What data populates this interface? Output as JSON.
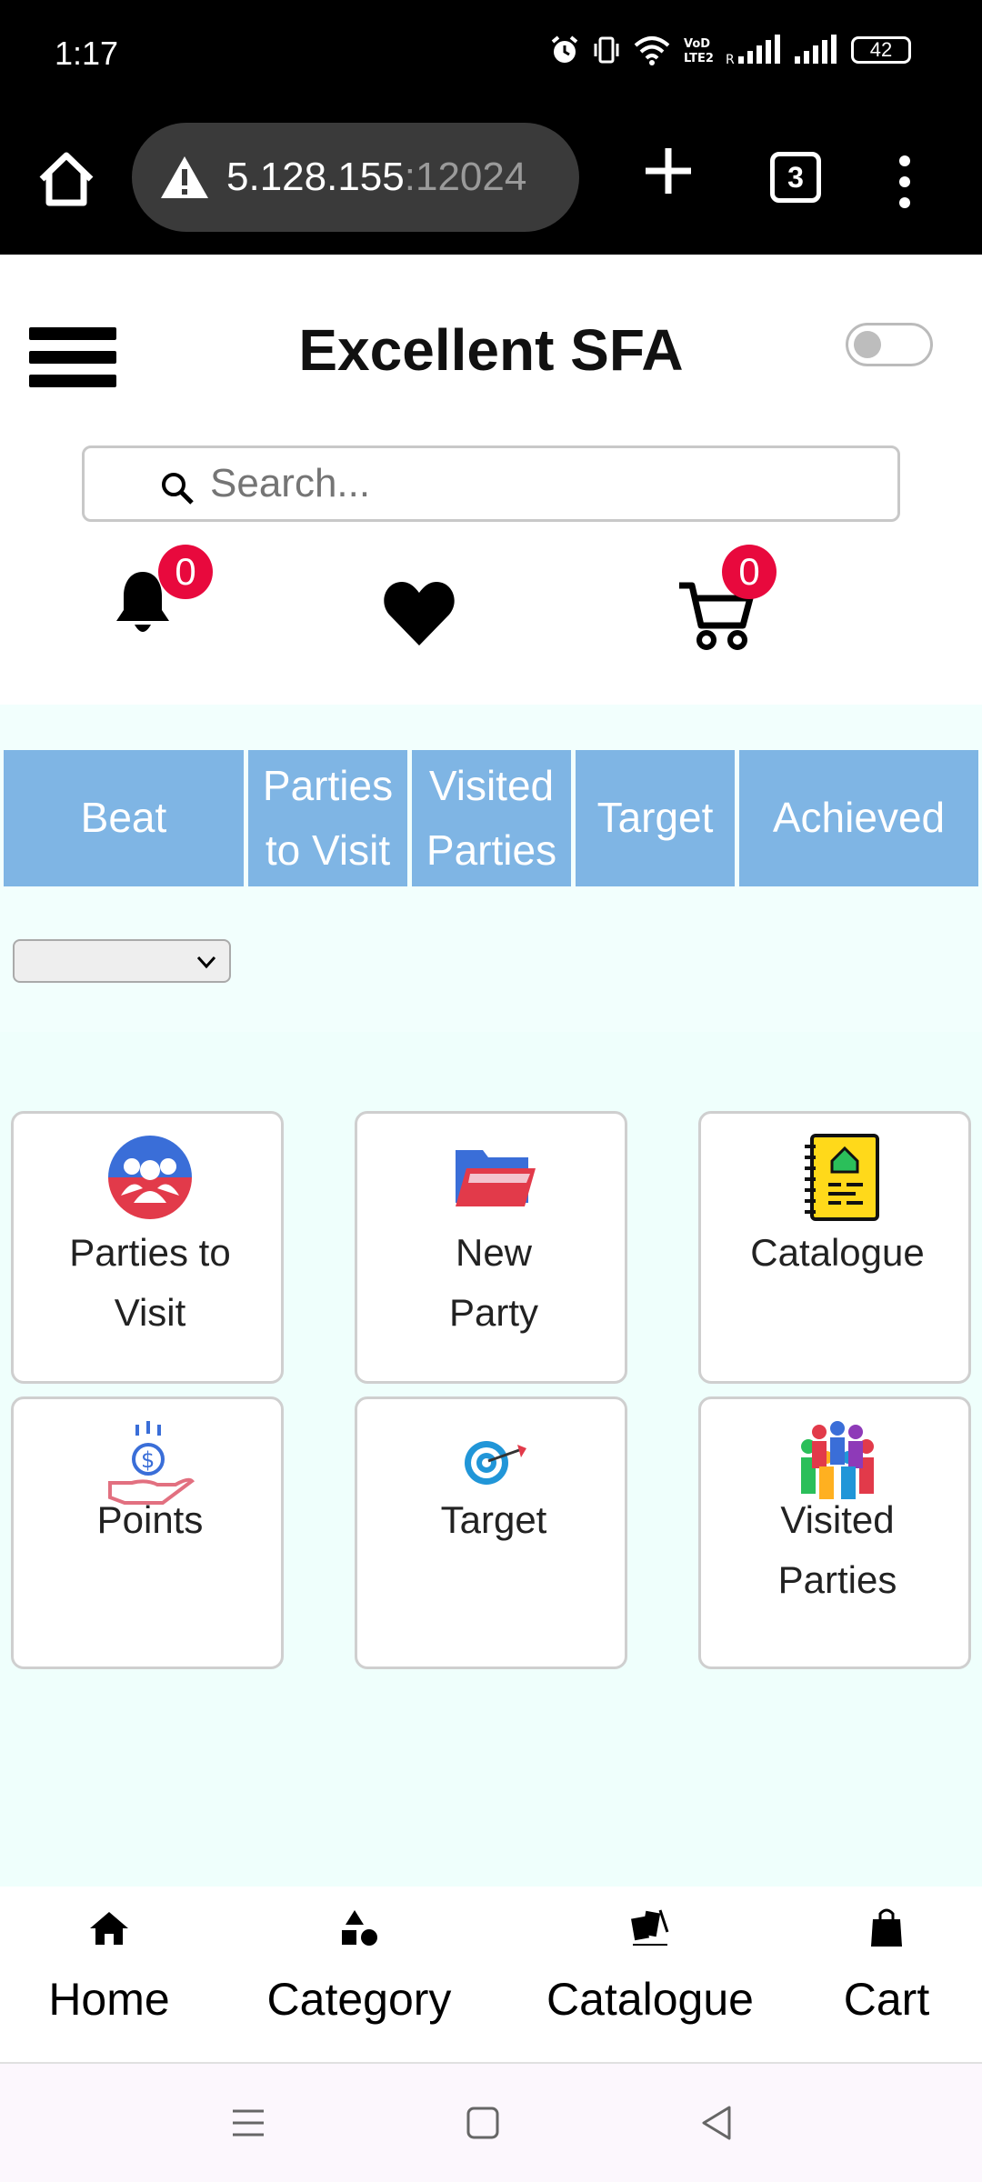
{
  "status_bar": {
    "time": "1:17",
    "battery": "42",
    "icons": [
      "alarm-icon",
      "vibrate-icon",
      "wifi-icon",
      "volte-icon",
      "signal-icon",
      "signal-icon"
    ]
  },
  "browser": {
    "url_host": "5.128.155",
    "url_port": ":12024",
    "tab_count": "3"
  },
  "app": {
    "title": "Excellent SFA",
    "search_placeholder": "Search...",
    "notifications_count": "0",
    "cart_count": "0"
  },
  "stats": [
    "Beat",
    "Parties to Visit",
    "Visited Parties",
    "Target",
    "Achieved"
  ],
  "beat_select": {
    "selected": ""
  },
  "tiles": [
    {
      "label": "Parties to Visit",
      "icon": "group-icon"
    },
    {
      "label": "New Party",
      "icon": "folder-icon"
    },
    {
      "label": "Catalogue",
      "icon": "notebook-icon"
    },
    {
      "label": "Points",
      "icon": "money-hand-icon"
    },
    {
      "label": "Target",
      "icon": "target-icon"
    },
    {
      "label": "Visited Parties",
      "icon": "people-circle-icon"
    }
  ],
  "bottom_nav": [
    {
      "label": "Home",
      "icon": "home-icon"
    },
    {
      "label": "Category",
      "icon": "shapes-icon"
    },
    {
      "label": "Catalogue",
      "icon": "catalogue-icon"
    },
    {
      "label": "Cart",
      "icon": "bag-icon"
    }
  ],
  "colors": {
    "stat_bg": "#7fb5e4",
    "badge": "#e8093d",
    "tiles_bg": "#effffc"
  }
}
